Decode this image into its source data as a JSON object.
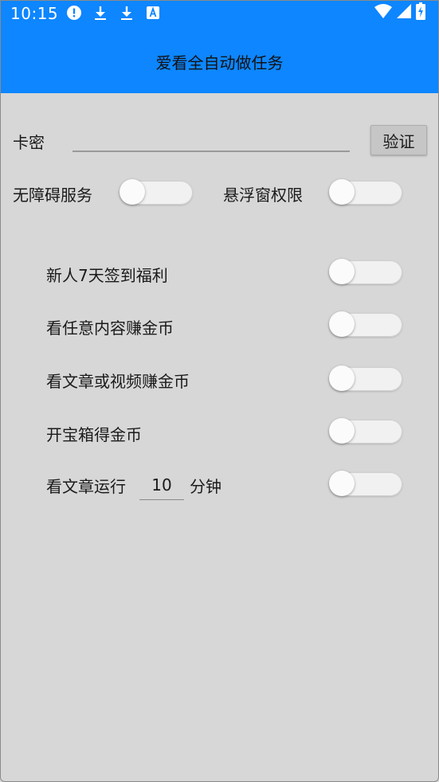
{
  "status_bar": {
    "time": "10:15",
    "icons_left": [
      "alert-circle-icon",
      "download-icon",
      "download-icon",
      "text-a-icon"
    ],
    "icons_right": [
      "wifi-icon",
      "signal-icon",
      "battery-charging-icon"
    ]
  },
  "app_bar": {
    "title": "爱看全自动做任务",
    "color": "#0d86ff"
  },
  "card_key": {
    "label": "卡密",
    "value": "",
    "placeholder": "",
    "verify_label": "验证"
  },
  "permissions": {
    "accessibility_label": "无障碍服务",
    "accessibility_on": false,
    "overlay_label": "悬浮窗权限",
    "overlay_on": false
  },
  "tasks": [
    {
      "label": "新人7天签到福利",
      "on": false
    },
    {
      "label": "看任意内容赚金币",
      "on": false
    },
    {
      "label": "看文章或视频赚金币",
      "on": false
    },
    {
      "label": "开宝箱得金币",
      "on": false
    }
  ],
  "read_article": {
    "label_before": "看文章运行",
    "minutes": "10",
    "label_after": "分钟",
    "on": false
  }
}
